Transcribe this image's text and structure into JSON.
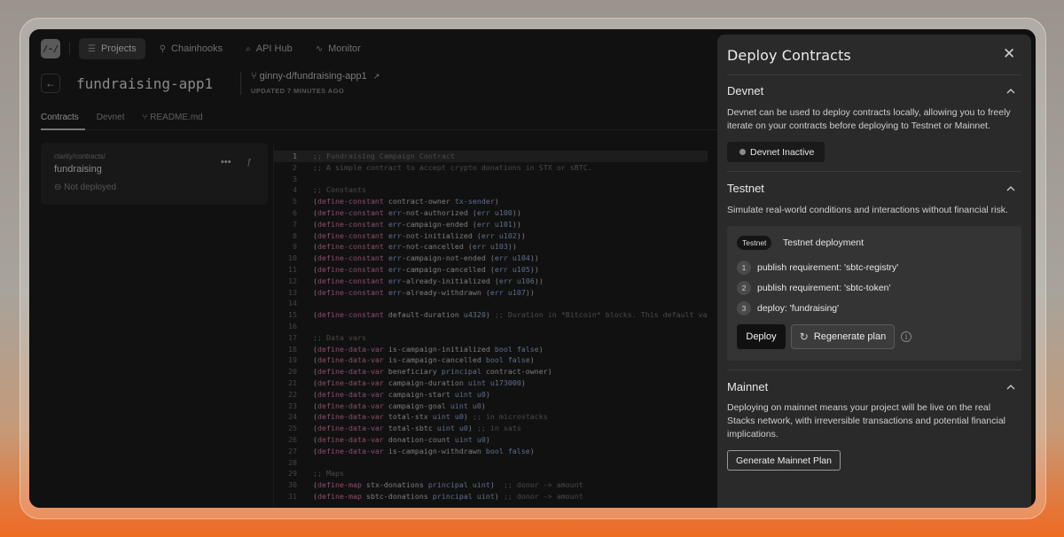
{
  "nav": {
    "logo": "/-/",
    "items": [
      {
        "label": "Projects",
        "icon": "list-icon"
      },
      {
        "label": "Chainhooks",
        "icon": "hook-icon"
      },
      {
        "label": "API Hub",
        "icon": "search-icon"
      },
      {
        "label": "Monitor",
        "icon": "pulse-icon"
      }
    ]
  },
  "project": {
    "title": "fundraising-app1",
    "repo": "ginny-d/fundraising-app1",
    "updated": "UPDATED 7 MINUTES AGO"
  },
  "tabs": [
    "Contracts",
    "Devnet",
    "README.md"
  ],
  "file": {
    "path": "clarity/contracts/",
    "name": "fundraising",
    "status": "Not deployed"
  },
  "code": {
    "lines": [
      ";; Fundraising Campaign Contract",
      ";; A simple contract to accept crypto donations in STX or sBTC.",
      "",
      ";; Constants",
      "(define-constant contract-owner tx-sender)",
      "(define-constant err-not-authorized (err u100))",
      "(define-constant err-campaign-ended (err u101))",
      "(define-constant err-not-initialized (err u102))",
      "(define-constant err-not-cancelled (err u103))",
      "(define-constant err-campaign-not-ended (err u104))",
      "(define-constant err-campaign-cancelled (err u105))",
      "(define-constant err-already-initialized (err u106))",
      "(define-constant err-already-withdrawn (err u107))",
      "",
      "(define-constant default-duration u4320) ;; Duration in *Bitcoin* blocks. This default va",
      "",
      ";; Data vars",
      "(define-data-var is-campaign-initialized bool false)",
      "(define-data-var is-campaign-cancelled bool false)",
      "(define-data-var beneficiary principal contract-owner)",
      "(define-data-var campaign-duration uint u173000)",
      "(define-data-var campaign-start uint u0)",
      "(define-data-var campaign-goal uint u0)",
      "(define-data-var total-stx uint u0) ;; in microstacks",
      "(define-data-var total-sbtc uint u0) ;; in sats",
      "(define-data-var donation-count uint u0)",
      "(define-data-var is-campaign-withdrawn bool false)",
      "",
      ";; Maps",
      "(define-map stx-donations principal uint)  ;; donor -> amount",
      "(define-map sbtc-donations principal uint) ;; donor -> amount"
    ]
  },
  "modal": {
    "title": "Deploy Contracts",
    "devnet": {
      "heading": "Devnet",
      "description": "Devnet can be used to deploy contracts locally, allowing you to freely iterate on your contracts before deploying to Testnet or Mainnet.",
      "status_label": "Devnet Inactive"
    },
    "testnet": {
      "heading": "Testnet",
      "description": "Simulate real-world conditions and interactions without financial risk.",
      "badge": "Testnet",
      "plan_title": "Testnet deployment",
      "steps": [
        {
          "num": "1",
          "label": "publish requirement: 'sbtc-registry'"
        },
        {
          "num": "2",
          "label": "publish requirement: 'sbtc-token'"
        },
        {
          "num": "3",
          "label": "deploy: 'fundraising'"
        }
      ],
      "deploy_label": "Deploy",
      "regen_label": "Regenerate plan"
    },
    "mainnet": {
      "heading": "Mainnet",
      "description": "Deploying on mainnet means your project will be live on the real Stacks network, with irreversible transactions and potential financial implications.",
      "generate_label": "Generate Mainnet Plan"
    }
  }
}
